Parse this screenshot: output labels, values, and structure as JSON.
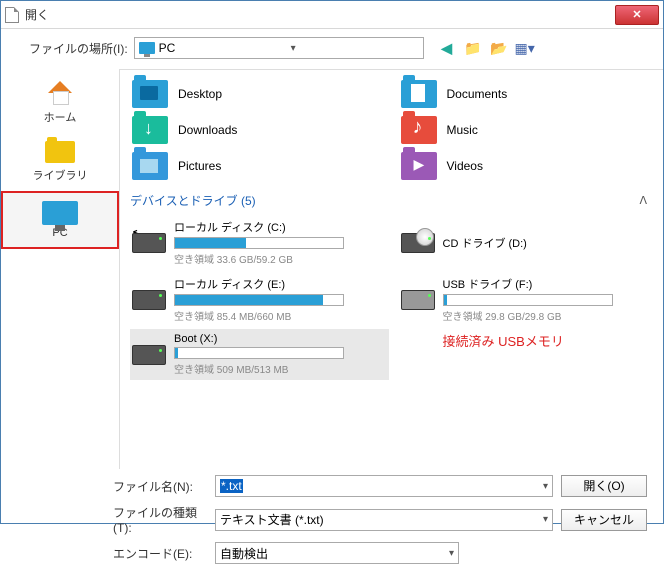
{
  "window": {
    "title": "開く"
  },
  "toolbar": {
    "location_label": "ファイルの場所(I):",
    "location_value": "PC"
  },
  "sidebar": {
    "items": [
      {
        "label": "ホーム"
      },
      {
        "label": "ライブラリ"
      },
      {
        "label": "PC"
      }
    ]
  },
  "folders": [
    {
      "name": "Desktop"
    },
    {
      "name": "Documents"
    },
    {
      "name": "Downloads"
    },
    {
      "name": "Music"
    },
    {
      "name": "Pictures"
    },
    {
      "name": "Videos"
    }
  ],
  "section": {
    "header": "デバイスとドライブ (5)"
  },
  "drives": [
    {
      "name": "ローカル ディスク (C:)",
      "fill_pct": 42,
      "space": "空き領域 33.6 GB/59.2 GB"
    },
    {
      "name": "CD ドライブ (D:)",
      "fill_pct": null,
      "space": ""
    },
    {
      "name": "ローカル ディスク (E:)",
      "fill_pct": 88,
      "space": "空き領域 85.4 MB/660 MB"
    },
    {
      "name": "USB ドライブ (F:)",
      "fill_pct": 2,
      "space": "空き領域 29.8 GB/29.8 GB"
    },
    {
      "name": "Boot (X:)",
      "fill_pct": 2,
      "space": "空き領域 509 MB/513 MB"
    }
  ],
  "annotation": "接続済み USBメモリ",
  "form": {
    "filename_label": "ファイル名(N):",
    "filename_value": "*.txt",
    "filetype_label": "ファイルの種類(T):",
    "filetype_value": "テキスト文書 (*.txt)",
    "encoding_label": "エンコード(E):",
    "encoding_value": "自動検出",
    "open_button": "開く(O)",
    "cancel_button": "キャンセル"
  }
}
